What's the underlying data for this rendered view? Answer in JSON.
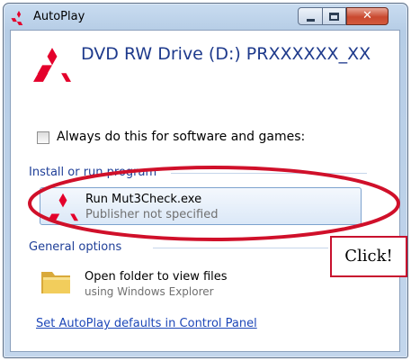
{
  "window": {
    "title": "AutoPlay",
    "caption_close": "✕"
  },
  "device": {
    "label": "DVD RW Drive (D:) PRXXXXXX_XX"
  },
  "always": {
    "label": "Always do this for software and games:",
    "checked": false
  },
  "install_section": {
    "heading": "Install or run program",
    "option": {
      "title": "Run Mut3Check.exe",
      "subtitle": "Publisher not specified"
    }
  },
  "general_section": {
    "heading": "General options",
    "option": {
      "title": "Open folder to view files",
      "subtitle": "using Windows Explorer"
    }
  },
  "footer": {
    "link": "Set AutoPlay defaults in Control Panel"
  },
  "annotation": {
    "callout": "Click!",
    "highlight_color": "#d0102a"
  },
  "colors": {
    "logo_red": "#e4002b",
    "link_blue": "#1d47b8",
    "heading_blue": "#1f3f98"
  },
  "icons": [
    "mitsubishi-logo-icon",
    "folder-icon"
  ]
}
